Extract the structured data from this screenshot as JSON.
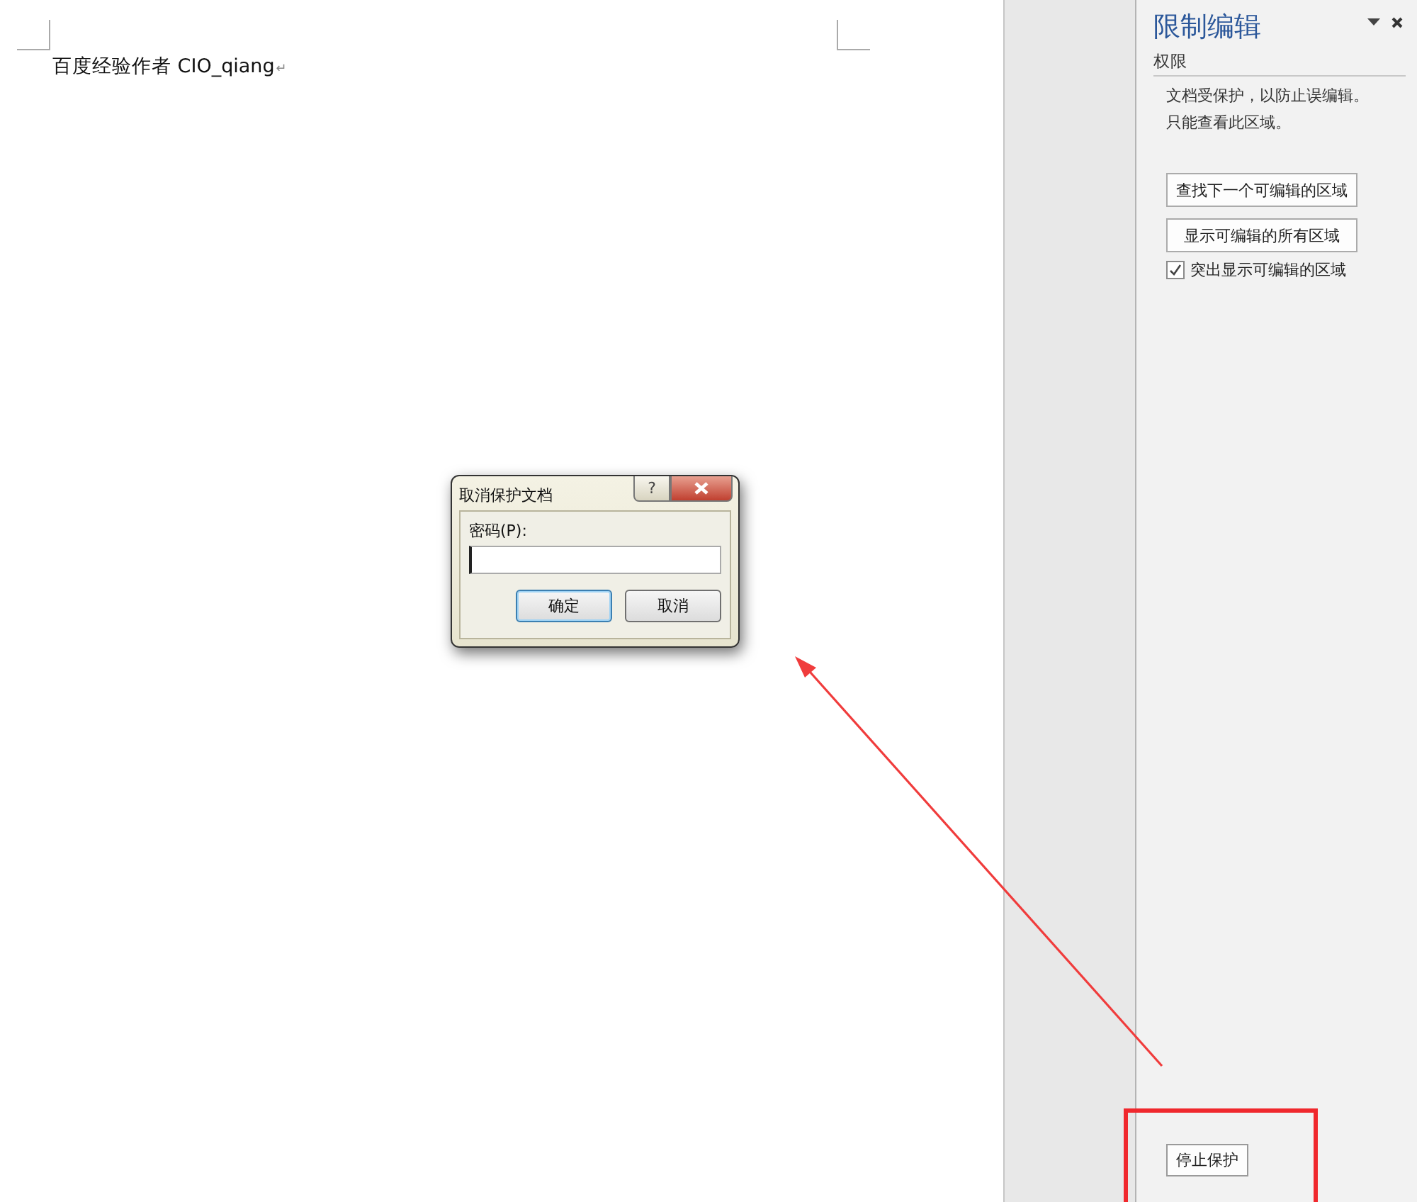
{
  "document": {
    "text": "百度经验作者 CIO_qiang",
    "paragraph_mark": "↵"
  },
  "panel": {
    "title": "限制编辑",
    "section": "权限",
    "description": [
      "文档受保护，以防止误编辑。",
      "只能查看此区域。"
    ],
    "buttons": [
      {
        "label": "查找下一个可编辑的区域"
      },
      {
        "label": "显示可编辑的所有区域"
      }
    ],
    "checkbox": {
      "label": "突出显示可编辑的区域",
      "checked": true
    },
    "stop_button": {
      "label": "停止保护"
    }
  },
  "dialog": {
    "title": "取消保护文档",
    "help": "?",
    "field_label": "密码(P):",
    "buttons": [
      {
        "label": "确定",
        "selected": true
      },
      {
        "label": "取消",
        "selected": false
      }
    ]
  }
}
